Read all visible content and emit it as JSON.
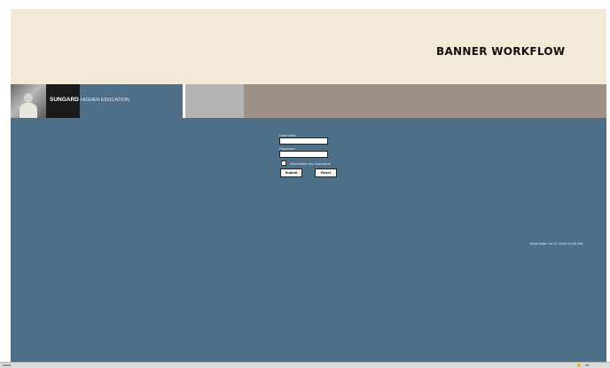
{
  "header": {
    "title": "BANNER WORKFLOW"
  },
  "branding": {
    "logo_text": "SUNGARD",
    "tagline": "HIGHER EDUCATION"
  },
  "login": {
    "username_label": "Username",
    "username_value": "",
    "password_label": "Password",
    "password_value": "",
    "remember_label": "Remember my Username",
    "remember_checked": false,
    "submit_label": "Submit",
    "reset_label": "Reset"
  },
  "build_date": "Build Date: 04-07-2010 04:00 AM",
  "status_bar": {
    "status_text": "Done",
    "zone_text": "Int"
  },
  "colors": {
    "header_bg": "#f2e9d9",
    "main_bg": "#4e6f88",
    "brand_strip": "#9e9087"
  }
}
